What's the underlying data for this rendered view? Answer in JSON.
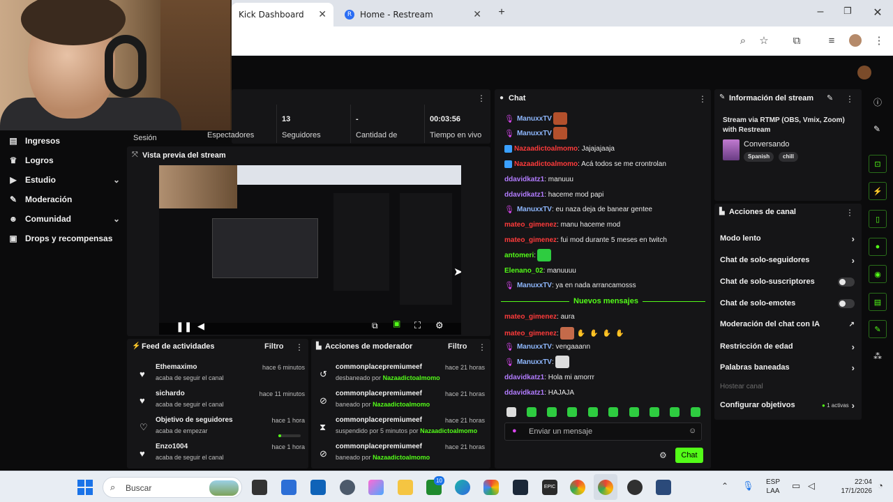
{
  "browser": {
    "tabs": [
      {
        "label": "Kick Dashboard",
        "active": true
      },
      {
        "label": "Home - Restream",
        "active": false
      }
    ],
    "new_tab": "+"
  },
  "sidebar": {
    "items": [
      {
        "label": "Sesión"
      },
      {
        "label": "Ingresos",
        "icon": "dollar-icon"
      },
      {
        "label": "Logros",
        "icon": "trophy-icon"
      },
      {
        "label": "Estudio",
        "icon": "video-icon",
        "expandable": true
      },
      {
        "label": "Moderación",
        "icon": "wrench-icon"
      },
      {
        "label": "Comunidad",
        "icon": "people-icon",
        "expandable": true
      },
      {
        "label": "Drops y recompensas",
        "icon": "gift-icon"
      }
    ]
  },
  "stats": [
    {
      "value": "",
      "label": "Espectadores"
    },
    {
      "value": "13",
      "label": "Seguidores"
    },
    {
      "value": "-",
      "label": "Cantidad de"
    },
    {
      "value": "00:03:56",
      "label": "Tiempo en vivo"
    }
  ],
  "preview": {
    "title": "Vista previa del stream"
  },
  "feed": {
    "title": "Feed de actividades",
    "filter": "Filtro",
    "rows": [
      {
        "name": "Ethemaximo",
        "sub": "acaba de seguir el canal",
        "time": "hace 6 minutos",
        "icon": "heart-icon"
      },
      {
        "name": "sichardo",
        "sub": "acaba de seguir el canal",
        "time": "hace 11 minutos",
        "icon": "heart-icon"
      },
      {
        "name": "Objetivo de seguidores",
        "sub": "acaba de empezar",
        "time": "hace 1 hora",
        "icon": "heart-outline-icon"
      },
      {
        "name": "Enzo1004",
        "sub": "acaba de seguir el canal",
        "time": "hace 1 hora",
        "icon": "heart-icon"
      }
    ]
  },
  "modactions": {
    "title": "Acciones de moderador",
    "filter": "Filtro",
    "rows": [
      {
        "name": "commonplacepremiumeef",
        "action": "desbaneado por",
        "by": "Nazaadictoalmomo",
        "time": "hace 21 horas",
        "icon": "undo-icon"
      },
      {
        "name": "commonplacepremiumeef",
        "action": "baneado por",
        "by": "Nazaadictoalmomo",
        "time": "hace 21 horas",
        "icon": "ban-icon"
      },
      {
        "name": "commonplacepremiumeef",
        "action": "suspendido por 5 minutos por",
        "by": "Nazaadictoalmomo",
        "time": "hace 21 horas",
        "icon": "hourglass-icon"
      },
      {
        "name": "commonplacepremiumeef",
        "action": "baneado por",
        "by": "Nazaadictoalmomo",
        "time": "hace 21 horas",
        "icon": "ban-icon"
      }
    ]
  },
  "chat": {
    "title": "Chat",
    "new_messages": "Nuevos mensajes",
    "input_placeholder": "Enviar un mensaje",
    "send_label": "Chat",
    "messages": [
      {
        "user": "ManuxxTV",
        "text": "",
        "color": "#8fb8ff",
        "mic": true,
        "emote": true
      },
      {
        "user": "ManuxxTV",
        "text": "",
        "color": "#8fb8ff",
        "mic": true,
        "emote": true
      },
      {
        "user": "Nazaadictoalmomo",
        "text": ": Jajajajaaja",
        "color": "#ff3b3b",
        "badge": true
      },
      {
        "user": "Nazaadictoalmomo",
        "text": ": Acá todos se me crontrolan",
        "color": "#ff3b3b",
        "badge": true
      },
      {
        "user": "ddavidkatz1",
        "text": ": manuuu",
        "color": "#b27cff"
      },
      {
        "user": "ddavidkatz1",
        "text": ": haceme mod papi",
        "color": "#b27cff"
      },
      {
        "user": "ManuxxTV",
        "text": ": eu naza deja de banear gentee",
        "color": "#8fb8ff",
        "mic": true
      },
      {
        "user": "mateo_gimenez",
        "text": ": manu haceme mod",
        "color": "#ff3b3b"
      },
      {
        "user": "mateo_gimenez",
        "text": ": fui mod durante 5 meses en twitch",
        "color": "#ff3b3b"
      },
      {
        "user": "antomeri",
        "text": ":",
        "color": "#53fc18",
        "emote": true
      },
      {
        "user": "Elenano_02",
        "text": ": manuuuu",
        "color": "#53fc18"
      },
      {
        "user": "ManuxxTV",
        "text": ": ya en nada arrancamosss",
        "color": "#8fb8ff",
        "mic": true
      },
      {
        "user": "mateo_gimenez",
        "text": ": aura",
        "color": "#ff3b3b"
      },
      {
        "user": "mateo_gimenez",
        "text": ":",
        "color": "#ff3b3b",
        "emote": true
      },
      {
        "user": "ManuxxTV",
        "text": ": vengaaann",
        "color": "#8fb8ff",
        "mic": true
      },
      {
        "user": "ManuxxTV",
        "text": ":",
        "color": "#8fb8ff",
        "mic": true,
        "emote": true
      },
      {
        "user": "ddavidkatz1",
        "text": ": Hola mi amorrr",
        "color": "#b27cff"
      },
      {
        "user": "ddavidkatz1",
        "text": ": HAJAJA",
        "color": "#b27cff"
      }
    ]
  },
  "streaminfo": {
    "title": "Información del stream",
    "stream_title": "Stream via RTMP (OBS, Vmix, Zoom) with Restream",
    "category": "Conversando",
    "tags": [
      "Spanish",
      "chill"
    ]
  },
  "channel_actions": {
    "title": "Acciones de canal",
    "items": [
      {
        "label": "Modo lento",
        "type": "arrow"
      },
      {
        "label": "Chat de solo-seguidores",
        "type": "arrow"
      },
      {
        "label": "Chat de solo-suscriptores",
        "type": "toggle"
      },
      {
        "label": "Chat de solo-emotes",
        "type": "toggle"
      },
      {
        "label": "Moderación del chat con IA",
        "type": "external"
      },
      {
        "label": "Restricción de edad",
        "type": "arrow"
      },
      {
        "label": "Palabras baneadas",
        "type": "arrow"
      },
      {
        "label": "Hostear canal",
        "type": "disabled"
      },
      {
        "label": "Configurar objetivos",
        "type": "arrow",
        "extra": "1 activas"
      }
    ]
  },
  "taskbar": {
    "search": "Buscar",
    "lang": "ESP",
    "lang2": "LAA",
    "time": "22:04",
    "date": "17/1/2026",
    "badge": "10"
  },
  "colors": {
    "accent": "#53fc18",
    "bg": "#0b0b0c",
    "panel": "#151517"
  }
}
